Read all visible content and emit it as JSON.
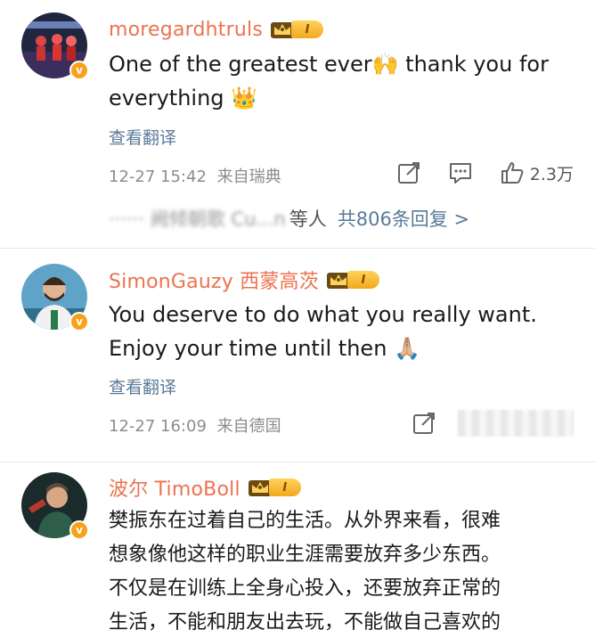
{
  "comments": [
    {
      "username": "moregardhtruls",
      "vip_level": "I",
      "text_line1": "One of the greatest ever🙌 thank you for",
      "text_line2": "everything 👑",
      "translate": "查看翻译",
      "time": "12-27 15:42",
      "source": "来自瑞典",
      "likes": "2.3万",
      "reply_names": "······ 阙倾朝歌 Cu...n",
      "reply_suffix": "等人",
      "replies_link": "共806条回复 >"
    },
    {
      "username": "SimonGauzy 西蒙高茨",
      "vip_level": "I",
      "text_line1": "You deserve to do what you really want.",
      "text_line2": "Enjoy your time until then 🙏🏼",
      "translate": "查看翻译",
      "time": "12-27 16:09",
      "source": "来自德国"
    },
    {
      "username": "波尔 TimoBoll",
      "vip_level": "I",
      "text_line1": "樊振东在过着自己的生活。从外界来看，很难",
      "text_line2": "想象像他这样的职业生涯需要放弃多少东西。",
      "text_line3": "不仅是在训练上全身心投入，还要放弃正常的",
      "text_line4": "生活，不能和朋友出去玩，不能做自己喜欢的"
    }
  ],
  "colors": {
    "username": "#eb7350",
    "link": "#5b7a98",
    "meta": "#8c8c8c",
    "vip_badge": "#f3a81c",
    "verified": "#f8a11b"
  }
}
